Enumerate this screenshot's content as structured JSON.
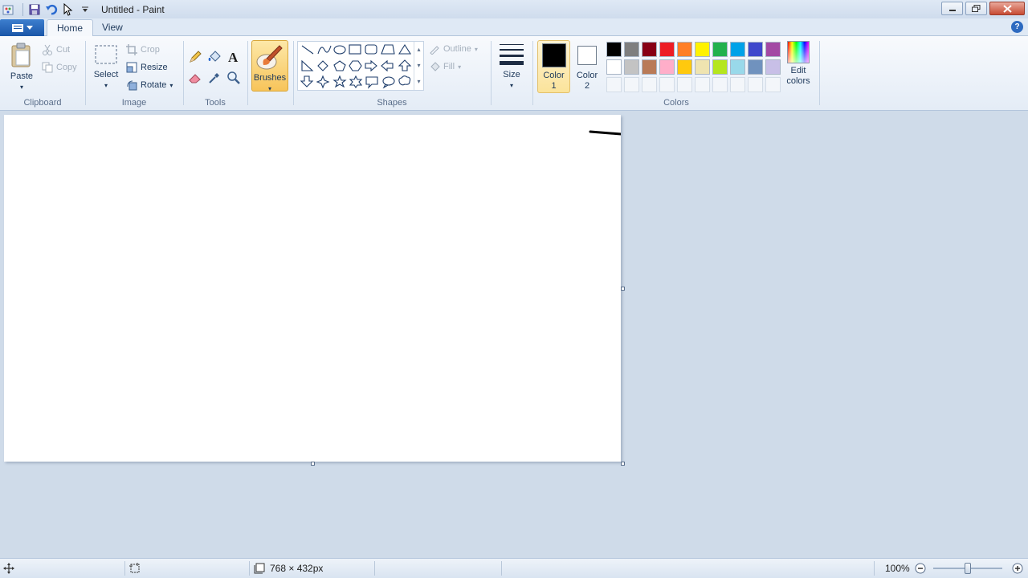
{
  "window": {
    "title": "Untitled - Paint"
  },
  "tabs": [
    {
      "label": "Home"
    },
    {
      "label": "View"
    }
  ],
  "clipboard": {
    "paste": "Paste",
    "cut": "Cut",
    "copy": "Copy",
    "group": "Clipboard"
  },
  "image": {
    "select": "Select",
    "crop": "Crop",
    "resize": "Resize",
    "rotate": "Rotate",
    "group": "Image"
  },
  "tools": {
    "group": "Tools"
  },
  "brushes": {
    "label": "Brushes"
  },
  "shapes": {
    "outline": "Outline",
    "fill": "Fill",
    "group": "Shapes"
  },
  "size": {
    "label": "Size"
  },
  "colors": {
    "color1": [
      "Color",
      "1"
    ],
    "color2": [
      "Color",
      "2"
    ],
    "edit": [
      "Edit",
      "colors"
    ],
    "group": "Colors",
    "palette_row1": [
      "#000000",
      "#7f7f7f",
      "#880015",
      "#ed1c24",
      "#ff7f27",
      "#fff200",
      "#22b14c",
      "#00a2e8",
      "#3f48cc",
      "#a349a4"
    ],
    "palette_row2": [
      "#ffffff",
      "#c3c3c3",
      "#b97a57",
      "#ffaec9",
      "#ffc90e",
      "#efe4b0",
      "#b5e61d",
      "#99d9ea",
      "#7092be",
      "#c8bfe7"
    ],
    "color1_value": "#000000",
    "color2_value": "#ffffff"
  },
  "status": {
    "image_size": "768 × 432px",
    "zoom": "100%",
    "zoom_level": 1.0
  }
}
